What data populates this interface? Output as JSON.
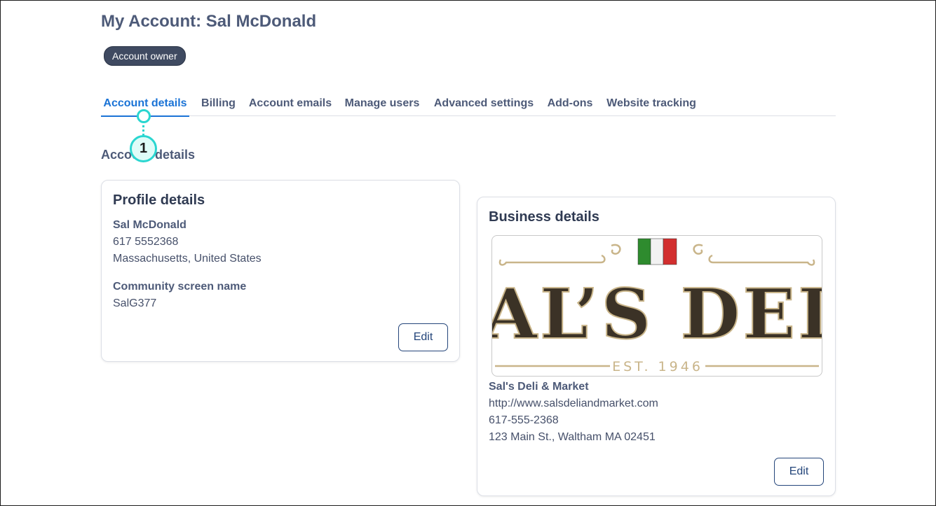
{
  "header": {
    "title": "My Account: Sal McDonald",
    "badge": "Account owner"
  },
  "tabs": [
    {
      "label": "Account details",
      "active": true
    },
    {
      "label": "Billing"
    },
    {
      "label": "Account emails"
    },
    {
      "label": "Manage users"
    },
    {
      "label": "Advanced settings"
    },
    {
      "label": "Add-ons"
    },
    {
      "label": "Website tracking"
    }
  ],
  "callout": {
    "number": "1"
  },
  "section_heading": "Account details",
  "profile": {
    "title": "Profile details",
    "name": "Sal McDonald",
    "phone": "617 5552368",
    "location": "Massachusetts, United States",
    "screen_name_label": "Community screen name",
    "screen_name": "SalG377",
    "edit_label": "Edit"
  },
  "business": {
    "title": "Business details",
    "logo": {
      "text": "AL’S DEL",
      "est": "EST. 1946",
      "flag_colors": [
        "#2e8b2e",
        "#f2f2f2",
        "#d22f2f"
      ]
    },
    "name": "Sal's Deli & Market",
    "website": "http://www.salsdeliandmarket.com",
    "phone": "617-555-2368",
    "address": "123 Main St., Waltham MA 02451",
    "edit_label": "Edit"
  },
  "colors": {
    "accent": "#1a73d6",
    "callout": "#2ad6d0",
    "badge_bg": "#3f4a61",
    "button_border": "#24457a"
  }
}
